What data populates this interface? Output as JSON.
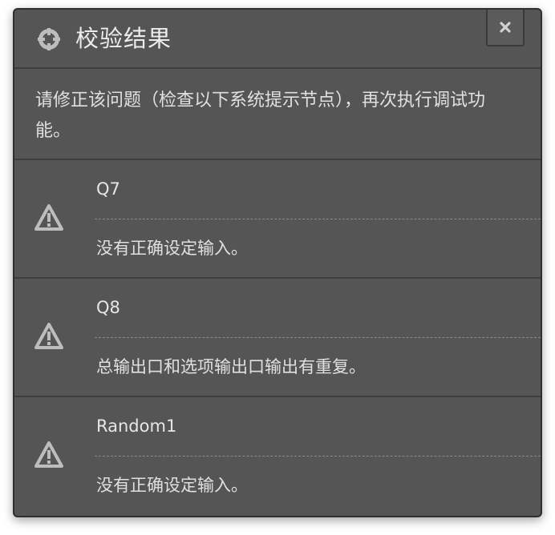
{
  "dialog": {
    "title": "校验结果",
    "title_icon": "crosshair-icon",
    "close_icon": "close-icon",
    "message": "请修正该问题（检查以下系统提示节点），再次执行调试功能。"
  },
  "issues": [
    {
      "name": "Q7",
      "icon": "warning-icon",
      "description": "没有正确设定输入。"
    },
    {
      "name": "Q8",
      "icon": "warning-icon",
      "description": "总输出口和选项输出口输出有重复。"
    },
    {
      "name": "Random1",
      "icon": "warning-icon",
      "description": "没有正确设定输入。"
    }
  ],
  "colors": {
    "dialog_background": "#555555",
    "text": "#e6e6e6",
    "icon": "#bdbdbd"
  }
}
